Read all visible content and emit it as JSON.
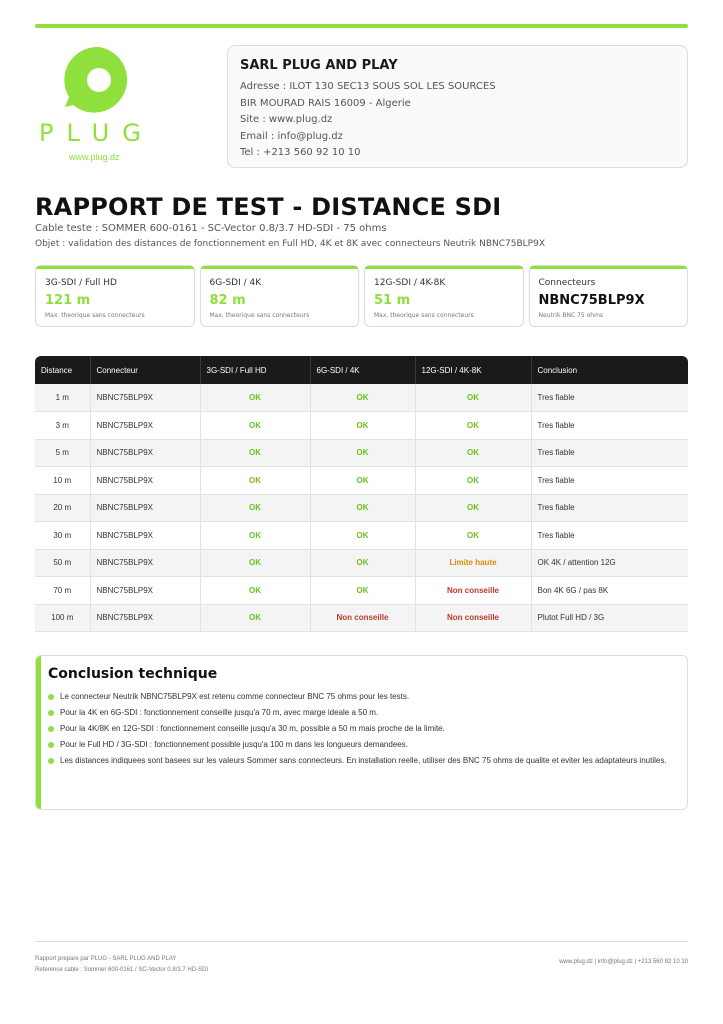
{
  "brand": {
    "logo_letters": "PLUG",
    "logo_url": "www.plug.dz",
    "accent_color": "#8fe03c"
  },
  "company": {
    "name": "SARL PLUG AND PLAY",
    "address1": "Adresse : ILOT 130 SEC13 SOUS SOL LES SOURCES",
    "address2": "BIR MOURAD RAIS 16009 - Algerie",
    "site": "Site : www.plug.dz",
    "email": "Email : info@plug.dz",
    "tel": "Tel : +213 560 92 10 10"
  },
  "report": {
    "title": "RAPPORT DE TEST - DISTANCE SDI",
    "cable": "Cable teste : SOMMER 600-0161 - SC-Vector 0.8/3.7 HD-SDI - 75 ohms",
    "objet": "Objet : validation des distances de fonctionnement en Full HD, 4K et 8K avec connecteurs Neutrik NBNC75BLP9X"
  },
  "kpis": [
    {
      "label": "3G-SDI / Full HD",
      "value": "121 m",
      "note": "Max. theorique sans connecteurs"
    },
    {
      "label": "6G-SDI / 4K",
      "value": "82 m",
      "note": "Max. theorique sans connecteurs"
    },
    {
      "label": "12G-SDI / 4K-8K",
      "value": "51 m",
      "note": "Max. theorique sans connecteurs"
    },
    {
      "label": "Connecteurs",
      "value": "NBNC75BLP9X",
      "note": "Neutrik BNC 75 ohms"
    }
  ],
  "table": {
    "headers": [
      "Distance",
      "Connecteur",
      "3G-SDI / Full HD",
      "6G-SDI / 4K",
      "12G-SDI / 4K-8K",
      "Conclusion"
    ],
    "rows": [
      {
        "distance": "1 m",
        "connecteur": "NBNC75BLP9X",
        "g3": "OK",
        "g6": "OK",
        "g12": "OK",
        "conclusion": "Tres fiable"
      },
      {
        "distance": "3 m",
        "connecteur": "NBNC75BLP9X",
        "g3": "OK",
        "g6": "OK",
        "g12": "OK",
        "conclusion": "Tres fiable"
      },
      {
        "distance": "5 m",
        "connecteur": "NBNC75BLP9X",
        "g3": "OK",
        "g6": "OK",
        "g12": "OK",
        "conclusion": "Tres fiable"
      },
      {
        "distance": "10 m",
        "connecteur": "NBNC75BLP9X",
        "g3": "OK",
        "g6": "OK",
        "g12": "OK",
        "conclusion": "Tres fiable"
      },
      {
        "distance": "20 m",
        "connecteur": "NBNC75BLP9X",
        "g3": "OK",
        "g6": "OK",
        "g12": "OK",
        "conclusion": "Tres fiable"
      },
      {
        "distance": "30 m",
        "connecteur": "NBNC75BLP9X",
        "g3": "OK",
        "g6": "OK",
        "g12": "OK",
        "conclusion": "Tres fiable"
      },
      {
        "distance": "50 m",
        "connecteur": "NBNC75BLP9X",
        "g3": "OK",
        "g6": "OK",
        "g12": "Limite haute",
        "conclusion": "OK 4K / attention 12G"
      },
      {
        "distance": "70 m",
        "connecteur": "NBNC75BLP9X",
        "g3": "OK",
        "g6": "OK",
        "g12": "Non conseille",
        "conclusion": "Bon 4K 6G / pas 8K"
      },
      {
        "distance": "100 m",
        "connecteur": "NBNC75BLP9X",
        "g3": "OK",
        "g6": "Non conseille",
        "g12": "Non conseille",
        "conclusion": "Plutot Full HD / 3G"
      }
    ],
    "status_colors": {
      "OK": "#6cc11e",
      "Limite haute": "#e08a00",
      "Non conseille": "#c0392b"
    }
  },
  "conclusion": {
    "title": "Conclusion technique",
    "items": [
      "Le connecteur Neutrik NBNC75BLP9X est retenu comme connecteur BNC 75 ohms pour les tests.",
      "Pour la 4K en 6G-SDI : fonctionnement conseille jusqu'a 70 m, avec marge ideale a 50 m.",
      "Pour la 4K/8K en 12G-SDI : fonctionnement conseille jusqu'a 30 m, possible a 50 m mais proche de la limite.",
      "Pour le Full HD / 3G-SDI : fonctionnement possible jusqu'a 100 m dans les longueurs demandees.",
      "Les distances indiquees sont basees sur les valeurs Sommer sans connecteurs. En installation reelle, utiliser des BNC 75 ohms de qualite et eviter les adaptateurs inutiles."
    ]
  },
  "footer": {
    "left1": "Rapport prepare par PLUG - SARL PLUG AND PLAY",
    "left2": "Reference cable : Sommer 600-0161 / SC-Vector 0.8/3.7 HD-SDI",
    "right": "www.plug.dz  |  info@plug.dz  |  +213 560 92 10 10"
  }
}
